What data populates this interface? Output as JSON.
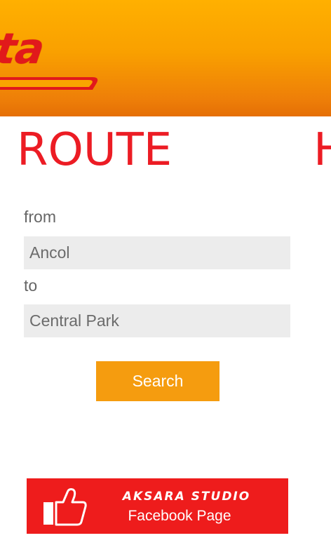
{
  "header": {
    "logo_text": "rta",
    "brand_colors": {
      "background": "#f9a000",
      "logo": "#e1191b"
    }
  },
  "pivot": {
    "current_title": "ROUTE",
    "next_title": "H",
    "accent_color": "#ec1c24"
  },
  "form": {
    "from_label": "from",
    "from_value": "Ancol",
    "to_label": "to",
    "to_value": "Central Park",
    "search_label": "Search",
    "button_color": "#f59c0f"
  },
  "facebook_banner": {
    "icon": "thumbs-up-icon",
    "studio_name": "AKSARA STUDIO",
    "page_label": "Facebook Page",
    "color": "#ee1c1c"
  }
}
